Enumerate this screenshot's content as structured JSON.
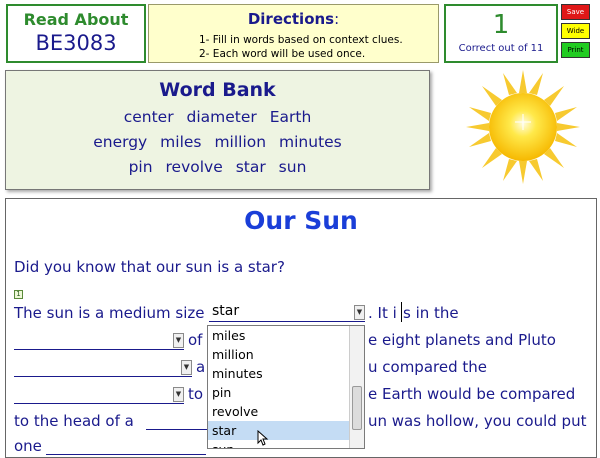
{
  "header": {
    "read_about_label": "Read About",
    "read_about_code": "BE3083",
    "directions_title": "Directions",
    "directions_colon": ":",
    "direction_1": "1- Fill in words based on context clues.",
    "direction_2": "2- Each word will be used once.",
    "score_value": "1",
    "score_label": "Correct out of 11",
    "buttons": {
      "save": "Save",
      "wide": "Wide",
      "print": "Print"
    }
  },
  "word_bank": {
    "title": "Word Bank",
    "rows": [
      [
        "center",
        "diameter",
        "Earth"
      ],
      [
        "energy",
        "miles",
        "million",
        "minutes"
      ],
      [
        "pin",
        "revolve",
        "star",
        "sun"
      ]
    ]
  },
  "passage": {
    "title": "Our Sun",
    "intro": "Did you know that our sun is a star?",
    "marker": "1",
    "line1_a": "The sun is a medium size",
    "line1_select_value": "star",
    "line1_b": ". It i",
    "line1_c": "s in the",
    "line2_b": "of",
    "line2_c": "e eight planets and Pluto",
    "line3_b": "a",
    "line3_c": "u compared the",
    "line4_b": "to",
    "line4_c": "e Earth would be compared",
    "line5_a": "to the head of a",
    "line5_c": "un was hollow, you could put",
    "line6_a": "one"
  },
  "dropdown": {
    "options": [
      "miles",
      "million",
      "minutes",
      "pin",
      "revolve",
      "star",
      "sun"
    ],
    "highlighted": "star"
  },
  "colors": {
    "accent_green": "#2e8b2e",
    "text_blue": "#1a1a8c",
    "title_blue": "#1a3ed8"
  }
}
